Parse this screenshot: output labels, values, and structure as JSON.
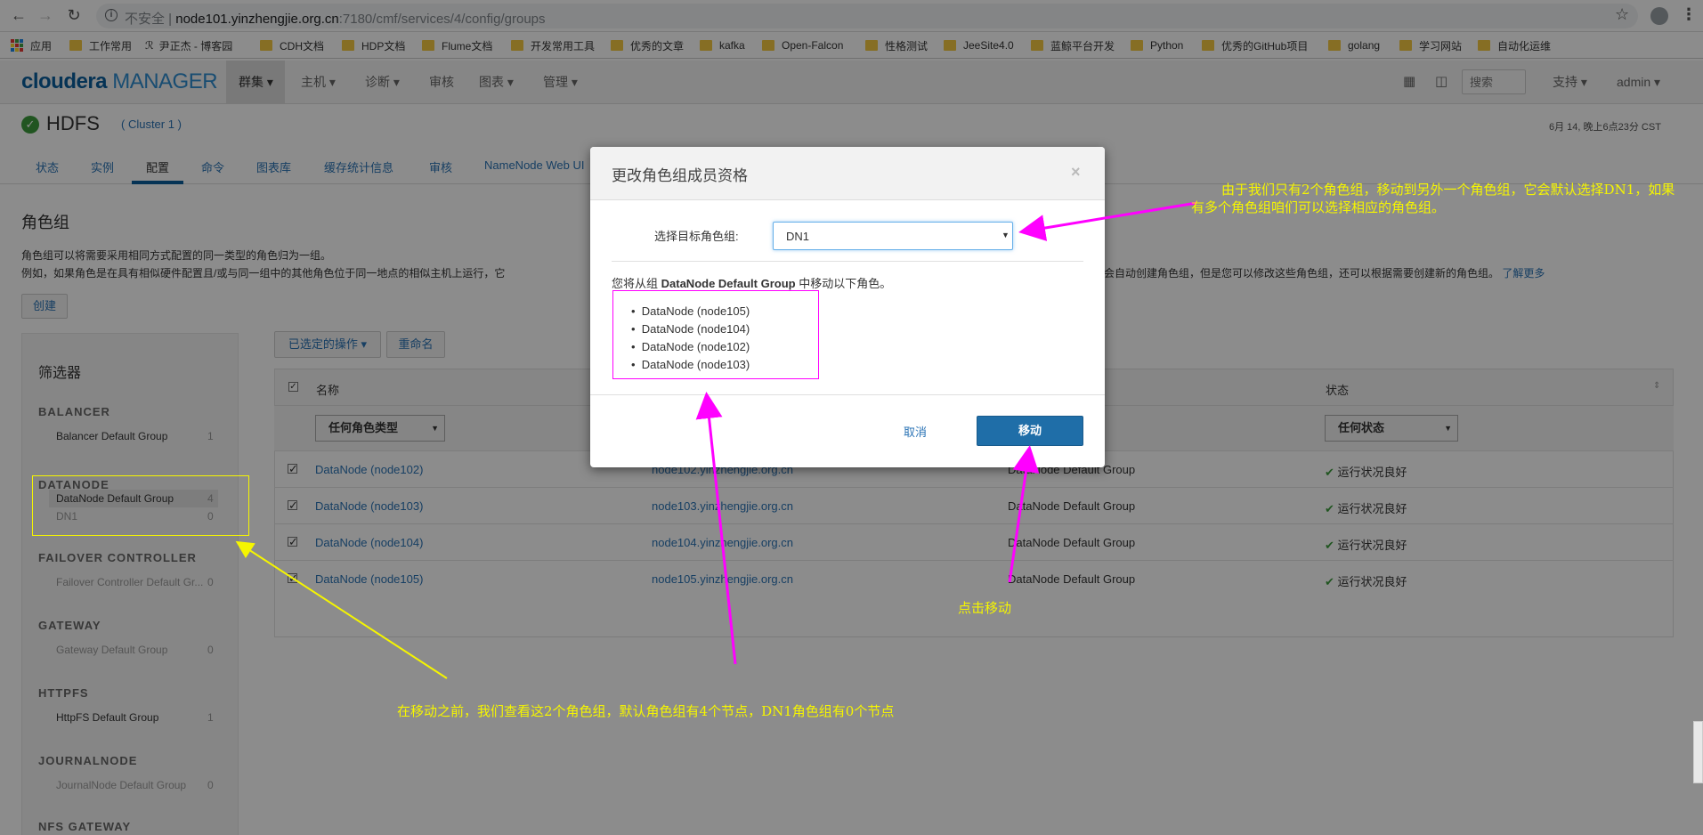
{
  "browser": {
    "security": "不安全",
    "url_host": "node101.yinzhengjie.org.cn",
    "url_path": ":7180/cmf/services/4/config/groups",
    "apps_label": "应用",
    "bookmarks": [
      "工作常用",
      "尹正杰 - 博客园",
      "CDH文档",
      "HDP文档",
      "Flume文档",
      "开发常用工具",
      "优秀的文章",
      "kafka",
      "Open-Falcon",
      "性格测试",
      "JeeSite4.0",
      "蓝鲸平台开发",
      "Python",
      "优秀的GitHub项目",
      "golang",
      "学习网站",
      "自动化运维"
    ]
  },
  "header": {
    "logo_main": "cloudera",
    "logo_sub": "MANAGER",
    "nav": [
      "群集",
      "主机",
      "诊断",
      "审核",
      "图表",
      "管理"
    ],
    "search_placeholder": "搜索",
    "support": "支持",
    "user": "admin"
  },
  "service": {
    "name": "HDFS",
    "cluster": "( Cluster 1 )",
    "timestamp": "6月 14, 晚上6点23分 CST",
    "tabs": [
      "状态",
      "实例",
      "配置",
      "命令",
      "图表库",
      "缓存统计信息",
      "审核",
      "NameNode Web UI"
    ]
  },
  "role_groups": {
    "title": "角色组",
    "desc1": "角色组可以将需要采用相同方式配置的同一类型的角色归为一组。",
    "desc2_left": "例如，如果角色是在具有相似硬件配置且/或与同一组中的其他角色位于同一地点的相似主机上运行，它",
    "desc2_right": "会自动创建角色组，但是您可以修改这些角色组，还可以根据需要创建新的角色组。",
    "learn_more": "了解更多",
    "create_label": "创建",
    "filter_title": "筛选器",
    "sections": [
      {
        "title": "BALANCER",
        "groups": [
          {
            "name": "Balancer Default Group",
            "count": "1"
          }
        ]
      },
      {
        "title": "DATANODE",
        "groups": [
          {
            "name": "DataNode Default Group",
            "count": "4"
          },
          {
            "name": "DN1",
            "count": "0"
          }
        ]
      },
      {
        "title": "FAILOVER CONTROLLER",
        "groups": [
          {
            "name": "Failover Controller Default Gr...",
            "count": "0"
          }
        ]
      },
      {
        "title": "GATEWAY",
        "groups": [
          {
            "name": "Gateway Default Group",
            "count": "0"
          }
        ]
      },
      {
        "title": "HTTPFS",
        "groups": [
          {
            "name": "HttpFS Default Group",
            "count": "1"
          }
        ]
      },
      {
        "title": "JOURNALNODE",
        "groups": [
          {
            "name": "JournalNode Default Group",
            "count": "0"
          }
        ]
      },
      {
        "title": "NFS GATEWAY",
        "groups": []
      }
    ],
    "actions_label": "已选定的操作",
    "rename_label": "重命名",
    "col_name": "名称",
    "col_status": "状态",
    "filter_role_type": "任何角色类型",
    "filter_status": "任何状态",
    "rows": [
      {
        "name": "DataNode (node102)",
        "host": "node102.yinzhengjie.org.cn",
        "group": "DataNode Default Group",
        "status": "运行状况良好"
      },
      {
        "name": "DataNode (node103)",
        "host": "node103.yinzhengjie.org.cn",
        "group": "DataNode Default Group",
        "status": "运行状况良好"
      },
      {
        "name": "DataNode (node104)",
        "host": "node104.yinzhengjie.org.cn",
        "group": "DataNode Default Group",
        "status": "运行状况良好"
      },
      {
        "name": "DataNode (node105)",
        "host": "node105.yinzhengjie.org.cn",
        "group": "DataNode Default Group",
        "status": "运行状况良好"
      }
    ]
  },
  "modal": {
    "title": "更改角色组成员资格",
    "close": "×",
    "target_label": "选择目标角色组:",
    "target_value": "DN1",
    "move_prefix": "您将从组 ",
    "move_group": "DataNode Default Group",
    "move_suffix": " 中移动以下角色。",
    "roles": [
      "DataNode (node105)",
      "DataNode (node104)",
      "DataNode (node102)",
      "DataNode (node103)"
    ],
    "cancel": "取消",
    "move": "移动"
  },
  "annotations": {
    "note_right_1": "由于我们只有2个角色组，移动到另外一个角色组，它会默认选择DN1，如果",
    "note_right_2": "有多个角色组咱们可以选择相应的角色组。",
    "note_click": "点击移动",
    "note_bottom": "在移动之前，我们查看这2个角色组，默认角色组有4个节点，DN1角色组有0个节点"
  },
  "colors": {
    "accent": "#0a5d9c",
    "primary_button": "#2a73b5",
    "annotation_magenta": "#ff00ff",
    "annotation_yellow": "#f5f500",
    "health_green": "#3c9c3c"
  }
}
